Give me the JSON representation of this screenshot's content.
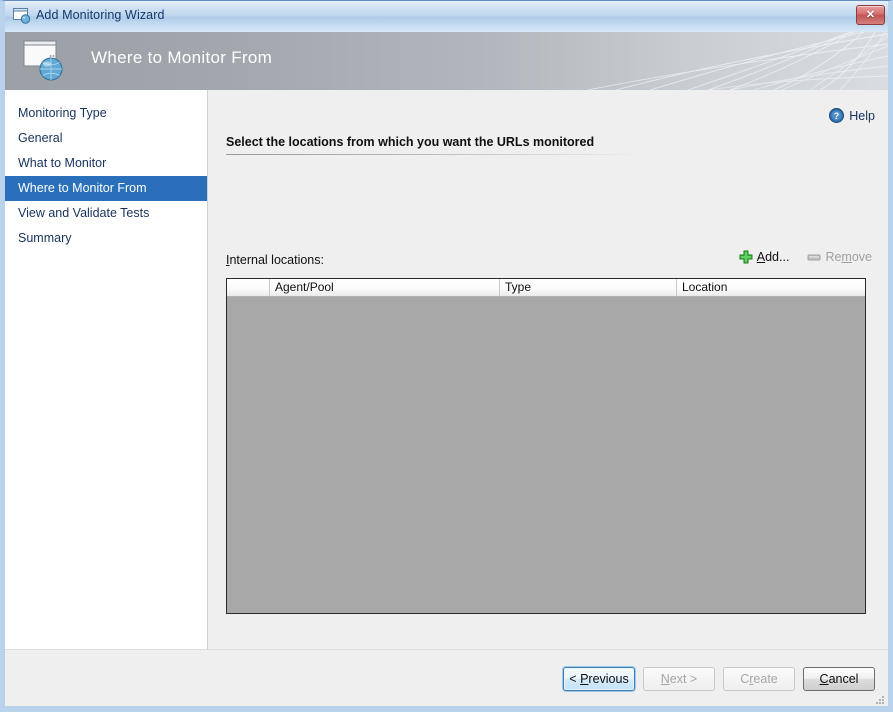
{
  "window": {
    "title": "Add Monitoring Wizard",
    "close_label": "✕",
    "title_icon": "wizard-window-globe-icon"
  },
  "banner": {
    "title": "Where to Monitor From",
    "icon": "monitor-globe-icon"
  },
  "sidebar": {
    "items": [
      {
        "label": "Monitoring Type",
        "selected": false
      },
      {
        "label": "General",
        "selected": false
      },
      {
        "label": "What to Monitor",
        "selected": false
      },
      {
        "label": "Where to Monitor From",
        "selected": true
      },
      {
        "label": "View and Validate Tests",
        "selected": false
      },
      {
        "label": "Summary",
        "selected": false
      }
    ]
  },
  "content": {
    "help": {
      "label": "Help",
      "icon": "help-question-icon"
    },
    "heading": "Select the locations from which you want the URLs monitored",
    "locations_label_prefix": "I",
    "locations_label_rest": "nternal locations:",
    "toolbar": {
      "add": {
        "accel": "A",
        "rest": "dd...",
        "icon": "green-plus-icon",
        "enabled": true
      },
      "remove": {
        "prefix": "Re",
        "accel": "m",
        "rest": "ove",
        "icon": "remove-pill-icon",
        "enabled": false
      }
    },
    "grid": {
      "columns": [
        {
          "label": "",
          "key": "selector"
        },
        {
          "label": "Agent/Pool",
          "key": "agent_pool"
        },
        {
          "label": "Type",
          "key": "type"
        },
        {
          "label": "Location",
          "key": "location"
        }
      ],
      "rows": []
    }
  },
  "footer": {
    "buttons": [
      {
        "prefix": "< ",
        "accel": "P",
        "rest": "revious",
        "state": "focused",
        "name": "previous-button"
      },
      {
        "prefix": "",
        "accel": "N",
        "rest": "ext >",
        "state": "disabled",
        "name": "next-button"
      },
      {
        "prefix": "C",
        "accel": "r",
        "rest": "eate",
        "state": "disabled",
        "name": "create-button"
      },
      {
        "prefix": "",
        "accel": "C",
        "rest": "ancel",
        "state": "default",
        "name": "cancel-button"
      }
    ]
  },
  "colors": {
    "accent_blue": "#2a6fba",
    "frame_blue": "#b9d3ec",
    "grid_body_gray": "#a8a8a8",
    "content_gray": "#efefef",
    "add_green": "#3ec23e"
  }
}
